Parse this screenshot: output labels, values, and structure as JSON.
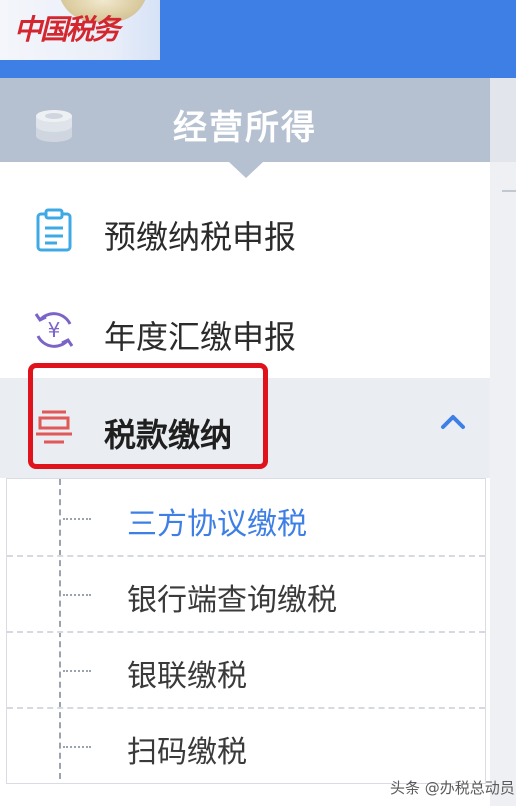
{
  "header": {
    "logo_text": "中国税务",
    "brand_color": "#3e7fe6"
  },
  "section": {
    "title": "经营所得",
    "icon": "coin-stack-icon"
  },
  "menu": {
    "items": [
      {
        "label": "预缴纳税申报",
        "icon": "clipboard-icon"
      },
      {
        "label": "年度汇缴申报",
        "icon": "yuan-cycle-icon"
      },
      {
        "label": "税款缴纳",
        "icon": "tax-receipt-icon",
        "expanded": true
      }
    ],
    "submenu": [
      {
        "label": "三方协议缴税",
        "active": true
      },
      {
        "label": "银行端查询缴税"
      },
      {
        "label": "银联缴税"
      },
      {
        "label": "扫码缴税"
      }
    ]
  },
  "annotation_color": "#e0121b",
  "watermark": "头条 @办税总动员"
}
